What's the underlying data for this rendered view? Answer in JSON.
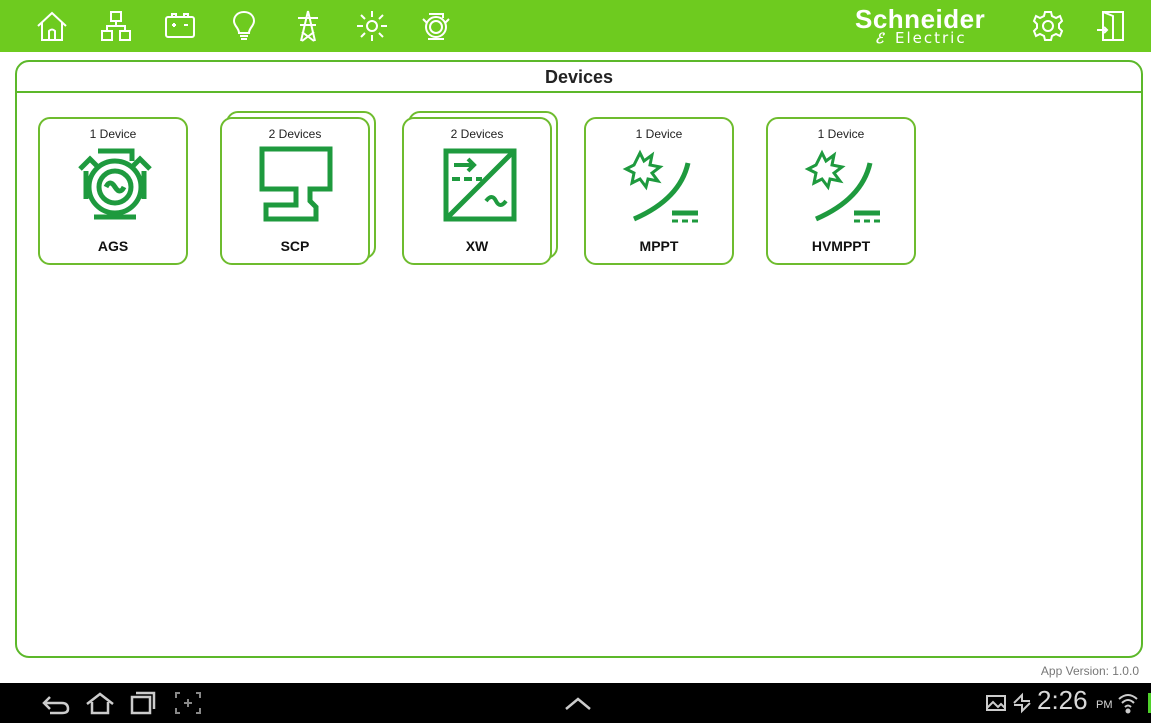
{
  "brand": {
    "name": "Schneider",
    "sub": "Electric"
  },
  "top_nav": [
    {
      "id": "home",
      "icon": "home-icon"
    },
    {
      "id": "system",
      "icon": "network-icon"
    },
    {
      "id": "battery",
      "icon": "battery-icon"
    },
    {
      "id": "light",
      "icon": "lightbulb-icon"
    },
    {
      "id": "grid",
      "icon": "transmission-tower-icon"
    },
    {
      "id": "solar",
      "icon": "sun-icon"
    },
    {
      "id": "generator",
      "icon": "generator-icon"
    }
  ],
  "top_right": [
    {
      "id": "settings",
      "icon": "gear-icon"
    },
    {
      "id": "exit",
      "icon": "exit-door-icon"
    }
  ],
  "page": {
    "title": "Devices"
  },
  "devices": [
    {
      "count": "1 Device",
      "label": "AGS",
      "icon": "generator-icon",
      "stacked": false
    },
    {
      "count": "2 Devices",
      "label": "SCP",
      "icon": "control-panel-icon",
      "stacked": true
    },
    {
      "count": "2 Devices",
      "label": "XW",
      "icon": "inverter-icon",
      "stacked": true
    },
    {
      "count": "1 Device",
      "label": "MPPT",
      "icon": "solar-charger-icon",
      "stacked": false
    },
    {
      "count": "1 Device",
      "label": "HVMPPT",
      "icon": "solar-charger-icon",
      "stacked": false
    }
  ],
  "footer": {
    "app_version": "App Version: 1.0.0"
  },
  "system_bar": {
    "time": "2:26",
    "ampm": "PM",
    "buttons": [
      "back-icon",
      "home-icon",
      "recent-apps-icon",
      "screenshot-icon"
    ]
  },
  "colors": {
    "accent": "#6ecb1f",
    "icon_green": "#1e9a3e",
    "border_green": "#6ebc2e"
  }
}
